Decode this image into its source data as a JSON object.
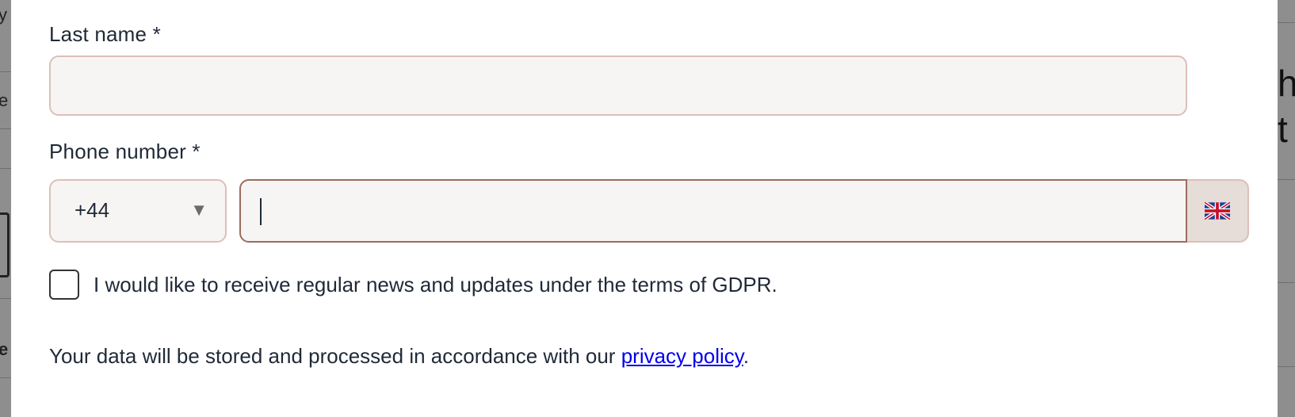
{
  "form": {
    "last_name_label": "Last name *",
    "last_name_value": "",
    "phone_label": "Phone number *",
    "country_code": "+44",
    "phone_value": "",
    "flag": "uk-flag-icon",
    "gdpr_text": "I would like to receive regular news and updates under the terms of GDPR.",
    "gdpr_checked": false,
    "privacy_prefix": "Your data will be stored and processed in accordance with our ",
    "privacy_link": "privacy policy",
    "privacy_suffix": "."
  },
  "background_fragments": {
    "left": [
      "y",
      "e",
      "e"
    ],
    "right": [
      "h",
      "t"
    ]
  },
  "colors": {
    "input_bg": "#f7f5f3",
    "input_border": "#dcbfb8",
    "focus_border": "#9c6c5f",
    "link": "#0000ee",
    "text": "#1f2937"
  }
}
